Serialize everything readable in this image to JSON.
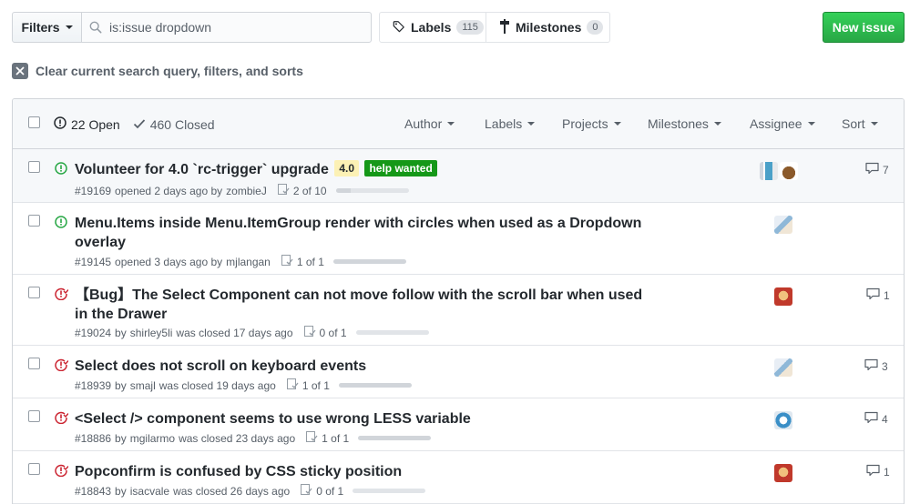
{
  "toolbar": {
    "filters_label": "Filters",
    "search_value": "is:issue dropdown",
    "labels_label": "Labels",
    "labels_count": "115",
    "milestones_label": "Milestones",
    "milestones_count": "0",
    "new_issue_label": "New issue",
    "clear_label": "Clear current search query, filters, and sorts"
  },
  "header": {
    "open_label": "22 Open",
    "closed_label": "460 Closed",
    "filters": [
      "Author",
      "Labels",
      "Projects",
      "Milestones",
      "Assignee",
      "Sort"
    ]
  },
  "colors": {
    "open_icon": "#28a745",
    "closed_icon": "#cb2431",
    "label_40_bg": "#fcf1b5",
    "label_40_fg": "#24292e",
    "label_help_bg": "#159818",
    "label_help_fg": "#ffffff"
  },
  "issues": [
    {
      "state": "open",
      "title": "Volunteer for 4.0 `rc-trigger` upgrade",
      "labels": [
        "4.0",
        "help wanted"
      ],
      "number": "#19169",
      "meta": "opened 2 days ago by",
      "author": "zombieJ",
      "tasks": "2 of 10",
      "progress": 0.2,
      "comments": "7"
    },
    {
      "state": "open",
      "title": "Menu.Items inside Menu.ItemGroup render with circles when used as a Dropdown overlay",
      "number": "#19145",
      "meta": "opened 3 days ago by",
      "author": "mjlangan",
      "tasks": "1 of 1",
      "progress": 1.0,
      "comments": ""
    },
    {
      "state": "closed",
      "title": "【Bug】The Select Component can not move follow with the scroll bar when used in the Drawer",
      "number": "#19024",
      "meta_by": "by",
      "author": "shirley5li",
      "meta": "was closed 17 days ago",
      "tasks": "0 of 1",
      "progress": 0.0,
      "comments": "1"
    },
    {
      "state": "closed",
      "title": "Select does not scroll on keyboard events",
      "number": "#18939",
      "meta_by": "by",
      "author": "smajl",
      "meta": "was closed 19 days ago",
      "tasks": "1 of 1",
      "progress": 1.0,
      "comments": "3"
    },
    {
      "state": "closed",
      "title": "<Select /> component seems to use wrong LESS variable",
      "number": "#18886",
      "meta_by": "by",
      "author": "mgilarmo",
      "meta": "was closed 23 days ago",
      "tasks": "1 of 1",
      "progress": 1.0,
      "comments": "4"
    },
    {
      "state": "closed",
      "title": "Popconfirm is confused by CSS sticky position",
      "number": "#18843",
      "meta_by": "by",
      "author": "isacvale",
      "meta": "was closed 26 days ago",
      "tasks": "0 of 1",
      "progress": 0.0,
      "comments": "1"
    }
  ]
}
